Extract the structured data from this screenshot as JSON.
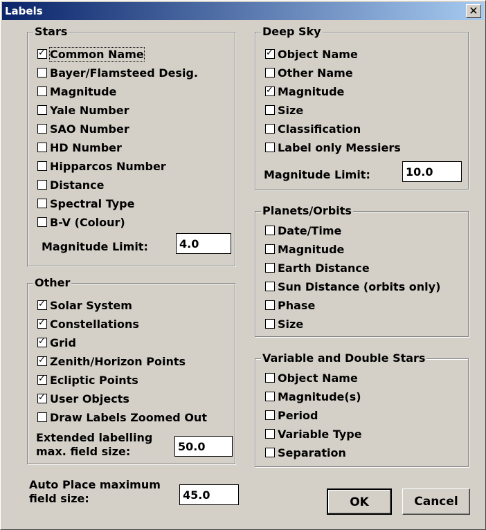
{
  "window": {
    "title": "Labels",
    "close": "✕"
  },
  "stars": {
    "legend": "Stars",
    "items": [
      {
        "label": "Common Name",
        "checked": true
      },
      {
        "label": "Bayer/Flamsteed Desig.",
        "checked": false
      },
      {
        "label": "Magnitude",
        "checked": false
      },
      {
        "label": "Yale Number",
        "checked": false
      },
      {
        "label": "SAO Number",
        "checked": false
      },
      {
        "label": "HD Number",
        "checked": false
      },
      {
        "label": "Hipparcos Number",
        "checked": false
      },
      {
        "label": "Distance",
        "checked": false
      },
      {
        "label": "Spectral Type",
        "checked": false
      },
      {
        "label": "B-V (Colour)",
        "checked": false
      }
    ],
    "mag_limit_label": "Magnitude Limit:",
    "mag_limit_value": "4.0"
  },
  "deepsky": {
    "legend": "Deep Sky",
    "items": [
      {
        "label": "Object Name",
        "checked": true
      },
      {
        "label": "Other Name",
        "checked": false
      },
      {
        "label": "Magnitude",
        "checked": true
      },
      {
        "label": "Size",
        "checked": false
      },
      {
        "label": "Classification",
        "checked": false
      },
      {
        "label": "Label only Messiers",
        "checked": false
      }
    ],
    "mag_limit_label": "Magnitude Limit:",
    "mag_limit_value": "10.0"
  },
  "planets": {
    "legend": "Planets/Orbits",
    "items": [
      {
        "label": "Date/Time",
        "checked": false
      },
      {
        "label": "Magnitude",
        "checked": false
      },
      {
        "label": "Earth Distance",
        "checked": false
      },
      {
        "label": "Sun Distance (orbits only)",
        "checked": false
      },
      {
        "label": "Phase",
        "checked": false
      },
      {
        "label": "Size",
        "checked": false
      }
    ]
  },
  "other": {
    "legend": "Other",
    "items": [
      {
        "label": "Solar System",
        "checked": true
      },
      {
        "label": "Constellations",
        "checked": true
      },
      {
        "label": "Grid",
        "checked": true
      },
      {
        "label": "Zenith/Horizon Points",
        "checked": true
      },
      {
        "label": "Ecliptic Points",
        "checked": true
      },
      {
        "label": "User Objects",
        "checked": true
      },
      {
        "label": "Draw Labels Zoomed Out",
        "checked": false
      }
    ],
    "ext_label_line1": "Extended labelling",
    "ext_label_line2": "max. field size:",
    "ext_value": "50.0"
  },
  "variable": {
    "legend": "Variable and Double Stars",
    "items": [
      {
        "label": "Object Name",
        "checked": false
      },
      {
        "label": "Magnitude(s)",
        "checked": false
      },
      {
        "label": "Period",
        "checked": false
      },
      {
        "label": "Variable Type",
        "checked": false
      },
      {
        "label": "Separation",
        "checked": false
      }
    ]
  },
  "autoplace": {
    "label_line1": "Auto Place maximum",
    "label_line2": "field size:",
    "value": "45.0"
  },
  "buttons": {
    "ok": "OK",
    "cancel": "Cancel"
  }
}
